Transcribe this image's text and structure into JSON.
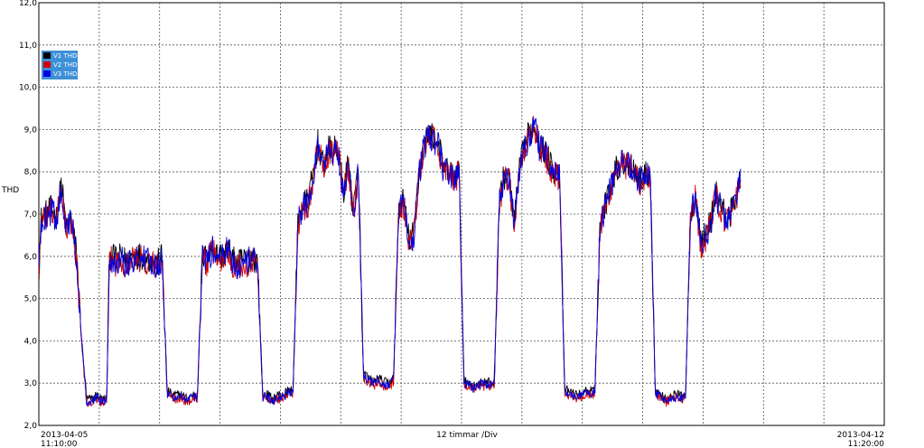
{
  "chart_data": {
    "type": "line",
    "title": "",
    "ylabel": "THD",
    "xlabel": "12 timmar /Div",
    "ylim": [
      2.0,
      12.0
    ],
    "yticks": [
      "12,0",
      "11,0",
      "10,0",
      "9,0",
      "8,0",
      "7,0",
      "6,0",
      "5,0",
      "4,0",
      "3,0",
      "2,0"
    ],
    "x_start_date": "2013-04-05",
    "x_start_time": "11:10:00",
    "x_end_date": "2013-04-12",
    "x_end_time": "11:20:00",
    "x_divisions": 14,
    "grid": true,
    "legend_position": "top-left",
    "series": [
      {
        "name": "V1 THD",
        "color": "#000000"
      },
      {
        "name": "V2 THD",
        "color": "#d40000"
      },
      {
        "name": "V3 THD",
        "color": "#0000e0"
      }
    ],
    "profile": {
      "x": [
        0,
        0.5,
        1.5,
        2.5,
        3.5,
        4.5,
        5.5,
        6.5,
        7.5,
        8.5,
        9.5,
        10.5,
        11.5,
        12.5,
        13.5,
        14,
        15.5,
        16.5,
        17.5,
        18.5,
        19.5,
        20.5,
        21.5,
        22.5,
        23.5,
        24.5,
        25.5,
        26.5,
        27.5,
        28.5,
        29.5,
        30.5,
        31.5,
        32.5,
        33.5,
        34.5,
        35.5,
        36.5,
        37.5,
        38.5,
        39.5,
        40.5,
        41.5,
        42.5,
        43.5,
        44.5,
        45.5,
        46.5,
        47.5,
        48.5,
        49.5,
        50.5,
        51.5,
        52.5,
        53.5,
        54.5,
        55.5,
        56.5,
        57.5,
        58.5,
        59.5,
        60.5,
        61.5,
        62.5,
        63.5,
        64.5,
        65.5,
        66.5,
        67.5,
        68.5,
        69.5,
        70.5,
        71.5,
        72.5,
        73.5,
        74.5,
        75.5,
        76.5,
        77.5,
        78.5,
        79.5,
        80.5,
        81.5,
        82.5,
        83.5,
        84.5,
        85.5,
        86.5,
        87.5,
        88.5,
        89.5,
        90.5,
        91.5,
        92.5,
        93.5,
        94.5,
        95.5,
        96.5,
        97.5,
        98.5,
        99.5,
        100.5,
        101.5,
        102.5,
        103.5,
        104.5,
        105.5,
        106.5,
        107.5,
        108.5,
        109.5,
        110.5,
        111.5,
        112.5,
        113.5,
        114.5,
        115.5,
        116.5,
        117.5,
        118.5,
        119.5,
        120.5,
        121.5,
        122.5,
        123.5,
        124.5,
        125.5,
        126.5,
        127.5,
        128.5,
        129.5,
        130.5,
        131.5,
        132.5,
        133.5,
        134.5,
        135.5,
        136.5,
        137.5,
        138.5,
        139.5,
        140.5,
        141.5,
        142.5,
        143.5,
        144.5,
        145.5,
        146.5,
        147.5,
        148.5,
        149.5,
        150.5,
        151.5,
        152.5,
        153.5,
        154.5,
        155.5,
        156.5,
        157.5,
        158.5,
        159.5,
        160.5,
        161.5,
        162.5,
        163.5,
        164.5,
        165.5,
        166.5,
        167.5,
        168
      ],
      "y": [
        5.7,
        6.9,
        7.0,
        7.1,
        6.9,
        7.7,
        6.6,
        6.9,
        6.0,
        4.0,
        2.6,
        2.6,
        2.7,
        2.6,
        2.6,
        6.0,
        5.9,
        6.0,
        5.8,
        6.0,
        6.0,
        6.0,
        5.9,
        5.9,
        5.8,
        6.0,
        2.8,
        2.7,
        2.7,
        2.7,
        2.6,
        2.7,
        2.7,
        6.0,
        5.9,
        6.2,
        6.0,
        6.0,
        6.2,
        5.9,
        5.8,
        5.9,
        5.9,
        6.0,
        5.8,
        2.7,
        2.7,
        2.6,
        2.7,
        2.7,
        2.8,
        2.8,
        6.8,
        7.2,
        7.3,
        7.9,
        8.7,
        8.1,
        8.5,
        8.5,
        8.5,
        7.5,
        8.2,
        7.0,
        8.1,
        3.2,
        3.1,
        3.0,
        3.1,
        3.0,
        3.0,
        3.1,
        7.1,
        7.3,
        6.4,
        6.5,
        7.9,
        8.6,
        8.9,
        8.8,
        8.6,
        8.0,
        8.0,
        7.9,
        8.0,
        3.0,
        3.0,
        2.9,
        3.0,
        3.0,
        3.0,
        3.0,
        7.3,
        7.9,
        7.8,
        6.8,
        8.0,
        8.6,
        8.9,
        9.1,
        8.6,
        8.5,
        8.2,
        8.0,
        7.9,
        2.8,
        2.8,
        2.7,
        2.7,
        2.8,
        2.8,
        2.8,
        6.7,
        7.2,
        7.6,
        8.0,
        8.2,
        8.2,
        8.2,
        8.0,
        7.8,
        7.9,
        8.0,
        2.8,
        2.7,
        2.6,
        2.7,
        2.7,
        2.7,
        2.7,
        7.0,
        7.5,
        6.3,
        6.5,
        6.8,
        7.5,
        7.2,
        6.9,
        7.0,
        7.3,
        8.0
      ]
    }
  }
}
